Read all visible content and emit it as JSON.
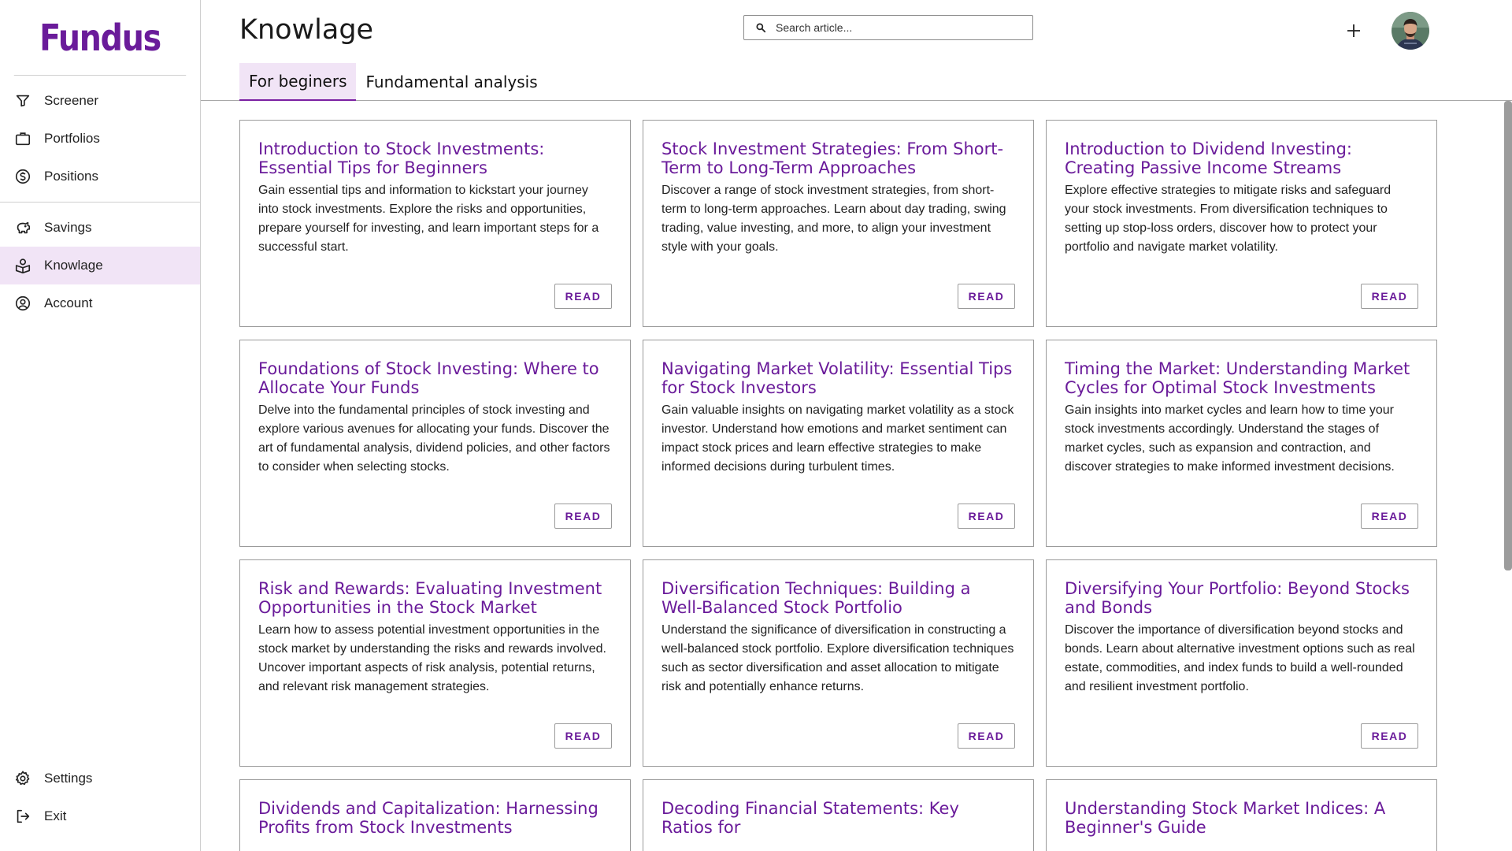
{
  "app": {
    "logo": "Fundus"
  },
  "sidebar": {
    "main_items": [
      {
        "label": "Screener",
        "icon": "filter-icon"
      },
      {
        "label": "Portfolios",
        "icon": "briefcase-icon"
      },
      {
        "label": "Positions",
        "icon": "dollar-circle-icon"
      }
    ],
    "secondary_items": [
      {
        "label": "Savings",
        "icon": "piggy-bank-icon"
      },
      {
        "label": "Knowlage",
        "icon": "knowledge-icon",
        "active": true
      },
      {
        "label": "Account",
        "icon": "user-circle-icon"
      }
    ],
    "bottom_items": [
      {
        "label": "Settings",
        "icon": "gear-icon"
      },
      {
        "label": "Exit",
        "icon": "exit-icon"
      }
    ]
  },
  "header": {
    "title": "Knowlage",
    "search_placeholder": "Search article...",
    "tabs": [
      {
        "label": "For beginers",
        "active": true
      },
      {
        "label": "Fundamental analysis",
        "active": false
      }
    ]
  },
  "colors": {
    "accent": "#6a1b9a",
    "active_bg": "#f1e4f6"
  },
  "read_label": "READ",
  "columns": [
    [
      {
        "title": "Introduction to Stock Investments: Essential Tips for Beginners",
        "text": "Gain essential tips and information to kickstart your journey into stock investments. Explore the risks and opportunities, prepare yourself for investing, and learn important steps for a successful start."
      },
      {
        "title": "Foundations of Stock Investing: Where to Allocate Your Funds",
        "text": "Delve into the fundamental principles of stock investing and explore various avenues for allocating your funds. Discover the art of fundamental analysis, dividend policies, and other factors to consider when selecting stocks."
      },
      {
        "title": "Risk and Rewards: Evaluating Investment Opportunities in the Stock Market",
        "text": "Learn how to assess potential investment opportunities in the stock market by understanding the risks and rewards involved. Uncover important aspects of risk analysis, potential returns, and relevant risk management strategies."
      },
      {
        "title": "Dividends and Capitalization: Harnessing Profits from Stock Investments",
        "text": ""
      }
    ],
    [
      {
        "title": "Stock Investment Strategies: From Short-Term to Long-Term Approaches",
        "text": "Discover a range of stock investment strategies, from short-term to long-term approaches. Learn about day trading, swing trading, value investing, and more, to align your investment style with your goals."
      },
      {
        "title": "Navigating Market Volatility: Essential Tips for Stock Investors",
        "text": "Gain valuable insights on navigating market volatility as a stock investor. Understand how emotions and market sentiment can impact stock prices and learn effective strategies to make informed decisions during turbulent times."
      },
      {
        "title": "Diversification Techniques: Building a Well-Balanced Stock Portfolio",
        "text": "Understand the significance of diversification in constructing a well-balanced stock portfolio. Explore diversification techniques such as sector diversification and asset allocation to mitigate risk and potentially enhance returns."
      },
      {
        "title": "Decoding Financial Statements: Key Ratios for",
        "text": ""
      }
    ],
    [
      {
        "title": "Introduction to Dividend Investing: Creating Passive Income Streams",
        "text": "Explore effective strategies to mitigate risks and safeguard your stock investments. From diversification techniques to setting up stop-loss orders, discover how to protect your portfolio and navigate market volatility."
      },
      {
        "title": "Timing the Market: Understanding Market Cycles for Optimal Stock Investments",
        "text": "Gain insights into market cycles and learn how to time your stock investments accordingly. Understand the stages of market cycles, such as expansion and contraction, and discover strategies to make informed investment decisions."
      },
      {
        "title": "Diversifying Your Portfolio: Beyond Stocks and Bonds",
        "text": "Discover the importance of diversification beyond stocks and bonds. Learn about alternative investment options such as real estate, commodities, and index funds to build a well-rounded and resilient investment portfolio."
      },
      {
        "title": "Understanding Stock Market Indices: A Beginner's Guide",
        "text": ""
      }
    ]
  ]
}
